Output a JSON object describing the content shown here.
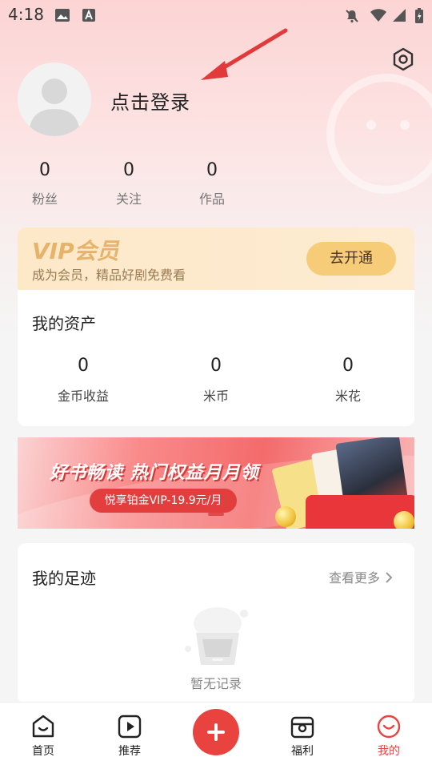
{
  "status_bar": {
    "time": "4:18"
  },
  "profile": {
    "login_prompt": "点击登录",
    "stats": [
      {
        "value": "0",
        "label": "粉丝"
      },
      {
        "value": "0",
        "label": "关注"
      },
      {
        "value": "0",
        "label": "作品"
      }
    ]
  },
  "vip": {
    "title": "VIP会员",
    "subtitle": "成为会员，精品好剧免费看",
    "button": "去开通"
  },
  "assets": {
    "title": "我的资产",
    "items": [
      {
        "value": "0",
        "label": "金币收益"
      },
      {
        "value": "0",
        "label": "米币"
      },
      {
        "value": "0",
        "label": "米花"
      }
    ]
  },
  "banner": {
    "title": "好书畅读 热门权益月月领",
    "pill": "悦享铂金VIP-19.9元/月"
  },
  "footprints": {
    "title": "我的足迹",
    "more": "查看更多",
    "empty": "暂无记录"
  },
  "tabbar": {
    "items": [
      {
        "label": "首页",
        "icon": "home-icon"
      },
      {
        "label": "推荐",
        "icon": "play-icon"
      },
      {
        "label": "",
        "icon": "plus-icon"
      },
      {
        "label": "福利",
        "icon": "gift-icon"
      },
      {
        "label": "我的",
        "icon": "smile-icon"
      }
    ],
    "active": "我的"
  },
  "colors": {
    "accent": "#e8433f",
    "vip_gold": "#e6b36a",
    "vip_button": "#f7cc79"
  }
}
